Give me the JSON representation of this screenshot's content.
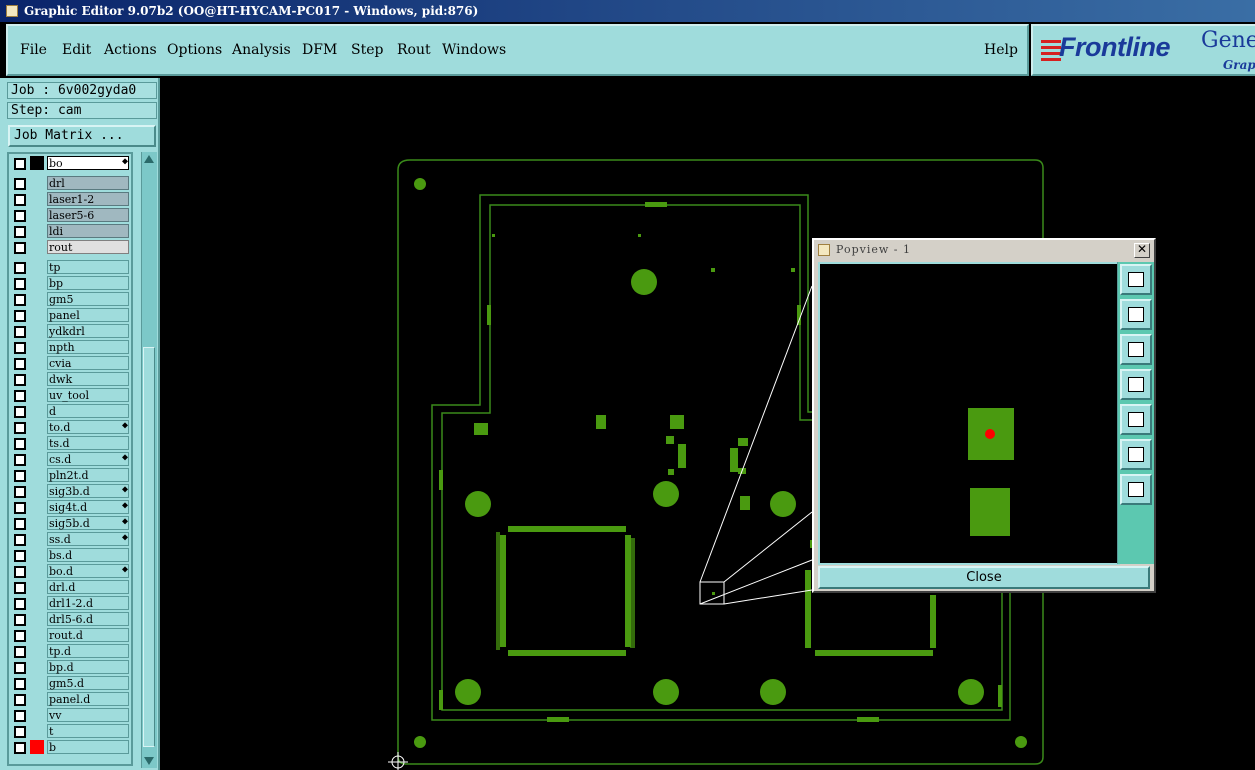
{
  "window": {
    "title": "Graphic Editor 9.07b2 (OO@HT-HYCAM-PC017 - Windows, pid:876)"
  },
  "menu": {
    "items": [
      "File",
      "Edit",
      "Actions",
      "Options",
      "Analysis",
      "DFM",
      "Step",
      "Rout",
      "Windows"
    ],
    "help": "Help"
  },
  "logo": {
    "brand": "Frontline",
    "product": "Gene",
    "sub": "Grap"
  },
  "job": {
    "job_label": "Job : 6v002gyda0",
    "step_label": "Step: cam",
    "matrix_button": "Job Matrix ..."
  },
  "layers": [
    {
      "name": "bo",
      "style": "work",
      "ind": "◆"
    },
    {
      "name": "drl",
      "style": "drill",
      "ind": ""
    },
    {
      "name": "laser1-2",
      "style": "drill",
      "ind": ""
    },
    {
      "name": "laser5-6",
      "style": "drill",
      "ind": ""
    },
    {
      "name": "ldi",
      "style": "drill",
      "ind": ""
    },
    {
      "name": "rout",
      "style": "rout",
      "ind": ""
    },
    {
      "name": "tp",
      "style": "misc",
      "ind": ""
    },
    {
      "name": "bp",
      "style": "misc",
      "ind": ""
    },
    {
      "name": "gm5",
      "style": "misc",
      "ind": ""
    },
    {
      "name": "panel",
      "style": "misc",
      "ind": ""
    },
    {
      "name": "ydkdrl",
      "style": "misc",
      "ind": ""
    },
    {
      "name": "npth",
      "style": "misc",
      "ind": ""
    },
    {
      "name": "cvia",
      "style": "misc",
      "ind": ""
    },
    {
      "name": "dwk",
      "style": "misc",
      "ind": ""
    },
    {
      "name": "uv_tool",
      "style": "misc",
      "ind": ""
    },
    {
      "name": "d",
      "style": "misc",
      "ind": ""
    },
    {
      "name": "to.d",
      "style": "misc",
      "ind": "◆"
    },
    {
      "name": "ts.d",
      "style": "misc",
      "ind": ""
    },
    {
      "name": "cs.d",
      "style": "misc",
      "ind": "◆"
    },
    {
      "name": "pln2t.d",
      "style": "misc",
      "ind": ""
    },
    {
      "name": "sig3b.d",
      "style": "misc",
      "ind": "◆"
    },
    {
      "name": "sig4t.d",
      "style": "misc",
      "ind": "◆"
    },
    {
      "name": "sig5b.d",
      "style": "misc",
      "ind": "◆"
    },
    {
      "name": "ss.d",
      "style": "misc",
      "ind": "◆"
    },
    {
      "name": "bs.d",
      "style": "misc",
      "ind": ""
    },
    {
      "name": "bo.d",
      "style": "misc",
      "ind": "◆"
    },
    {
      "name": "drl.d",
      "style": "misc",
      "ind": ""
    },
    {
      "name": "drl1-2.d",
      "style": "misc",
      "ind": ""
    },
    {
      "name": "drl5-6.d",
      "style": "misc",
      "ind": ""
    },
    {
      "name": "rout.d",
      "style": "misc",
      "ind": ""
    },
    {
      "name": "tp.d",
      "style": "misc",
      "ind": ""
    },
    {
      "name": "bp.d",
      "style": "misc",
      "ind": ""
    },
    {
      "name": "gm5.d",
      "style": "misc",
      "ind": ""
    },
    {
      "name": "panel.d",
      "style": "misc",
      "ind": ""
    },
    {
      "name": "vv",
      "style": "misc",
      "ind": ""
    },
    {
      "name": "t",
      "style": "misc",
      "ind": ""
    },
    {
      "name": "b",
      "style": "misc",
      "ind": "",
      "marked": true
    }
  ],
  "popview": {
    "title": "Popview - 1",
    "close_label": "Close"
  },
  "colors": {
    "panel": "#9fdcdc",
    "copper": "#4a9a10",
    "outline": "#3a8a1a",
    "marker": "#ff0000"
  },
  "icons": [
    "close-icon",
    "zoom-fit-icon",
    "pan-up-icon",
    "pan-down-icon",
    "pan-left-icon",
    "pan-right-icon",
    "zoom-in-icon",
    "zoom-out-icon",
    "crosshair-origin-icon"
  ]
}
